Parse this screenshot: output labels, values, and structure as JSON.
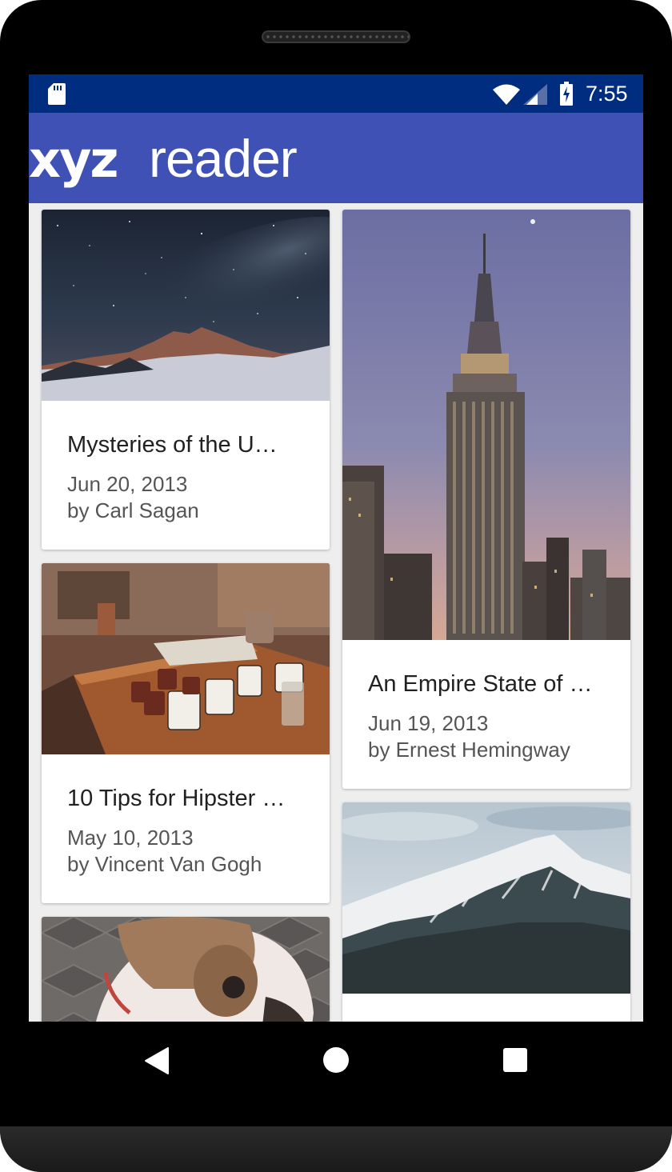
{
  "status_bar": {
    "time": "7:55",
    "icons": [
      "sd-card-icon",
      "wifi-icon",
      "cell-signal-icon",
      "battery-charging-icon"
    ]
  },
  "app": {
    "logo_bold": "xyz",
    "logo_light": "reader",
    "toolbar_color": "#3f51b5",
    "status_color": "#002d80"
  },
  "articles": [
    {
      "title": "Mysteries of the U…",
      "date": "Jun 20, 2013",
      "author": "by Carl Sagan",
      "image": "night-sky-mountain"
    },
    {
      "title": "An Empire State of …",
      "date": "Jun 19, 2013",
      "author": "by Ernest Hemingway",
      "image": "empire-state-building"
    },
    {
      "title": "10 Tips for Hipster …",
      "date": "May 10, 2013",
      "author": "by Vincent Van Gogh",
      "image": "enamel-cups-table"
    },
    {
      "image": "bulldog"
    },
    {
      "image": "snowy-mountain"
    }
  ],
  "nav_bar": {
    "back": "back",
    "home": "home",
    "recents": "recents"
  }
}
